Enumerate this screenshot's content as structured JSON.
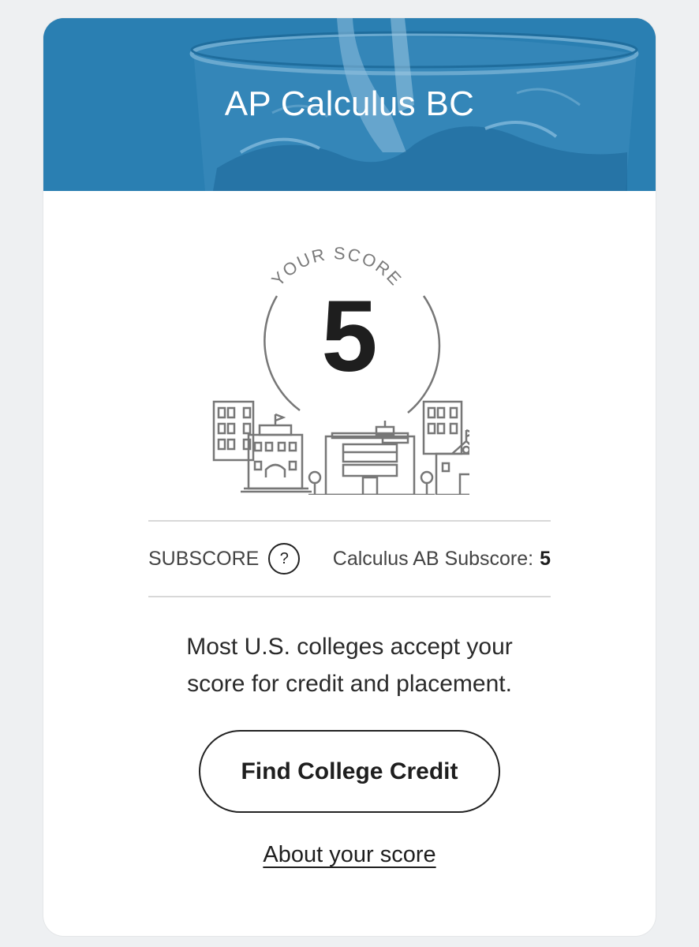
{
  "header": {
    "course_title": "AP Calculus BC",
    "background_color": "#2a7fb2",
    "background_image": "glass-of-water-photo"
  },
  "score": {
    "label": "YOUR SCORE",
    "value": "5",
    "illustration": "college-campus-buildings-icon"
  },
  "subscore": {
    "label": "SUBSCORE",
    "help_icon_text": "?",
    "text": "Calculus AB Subscore:",
    "value": "5"
  },
  "message": {
    "line1": "Most U.S. colleges accept your",
    "line2": "score for credit and placement."
  },
  "actions": {
    "primary_label": "Find College Credit",
    "secondary_link": "About your score"
  }
}
